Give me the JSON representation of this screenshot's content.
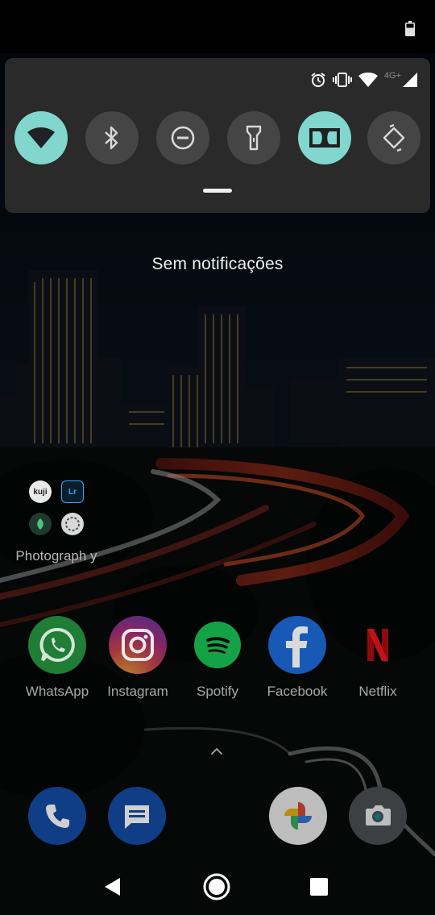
{
  "status_bar": {
    "network_type": "4G+",
    "icons": [
      "battery-icon",
      "alarm-icon",
      "vibrate-icon",
      "wifi-icon",
      "cell-signal-icon"
    ]
  },
  "quick_settings": {
    "tiles": [
      {
        "name": "wifi",
        "icon": "wifi-icon",
        "active": true
      },
      {
        "name": "bluetooth",
        "icon": "bluetooth-icon",
        "active": false
      },
      {
        "name": "do-not-disturb",
        "icon": "do-not-disturb-icon",
        "active": false
      },
      {
        "name": "flashlight",
        "icon": "flashlight-icon",
        "active": false
      },
      {
        "name": "dolby",
        "icon": "dolby-icon",
        "active": true
      },
      {
        "name": "auto-rotate",
        "icon": "auto-rotate-icon",
        "active": false
      }
    ],
    "colors": {
      "panel": "#2a2a2a",
      "tile_active": "#81d7cd",
      "tile_inactive": "#454545"
    }
  },
  "notifications": {
    "empty_text": "Sem notificações"
  },
  "home": {
    "folder": {
      "label": "Photograph y",
      "apps": [
        {
          "icon": "kuji-cam-icon",
          "text": "kuji"
        },
        {
          "icon": "lightroom-icon",
          "text": "Lr"
        },
        {
          "icon": "snapseed-icon",
          "text": ""
        },
        {
          "icon": "camera-lens-icon",
          "text": ""
        }
      ]
    },
    "apps": [
      {
        "label": "WhatsApp",
        "icon": "whatsapp-icon",
        "color": "#2db742"
      },
      {
        "label": "Instagram",
        "icon": "instagram-icon",
        "color": "#c13584"
      },
      {
        "label": "Spotify",
        "icon": "spotify-icon",
        "color": "#1ed760"
      },
      {
        "label": "Facebook",
        "icon": "facebook-icon",
        "color": "#1877f2"
      },
      {
        "label": "Netflix",
        "icon": "netflix-icon",
        "color": "#e50914"
      }
    ],
    "dock": [
      {
        "icon": "phone-icon",
        "color": "#1a73e8"
      },
      {
        "icon": "messages-icon",
        "color": "#1a73e8"
      },
      {
        "icon": "google-photos-icon",
        "color": "#ffffff"
      },
      {
        "icon": "camera-icon",
        "color": "#5f6368"
      }
    ]
  },
  "nav_bar": {
    "buttons": [
      "back-icon",
      "home-icon",
      "recents-icon"
    ]
  }
}
